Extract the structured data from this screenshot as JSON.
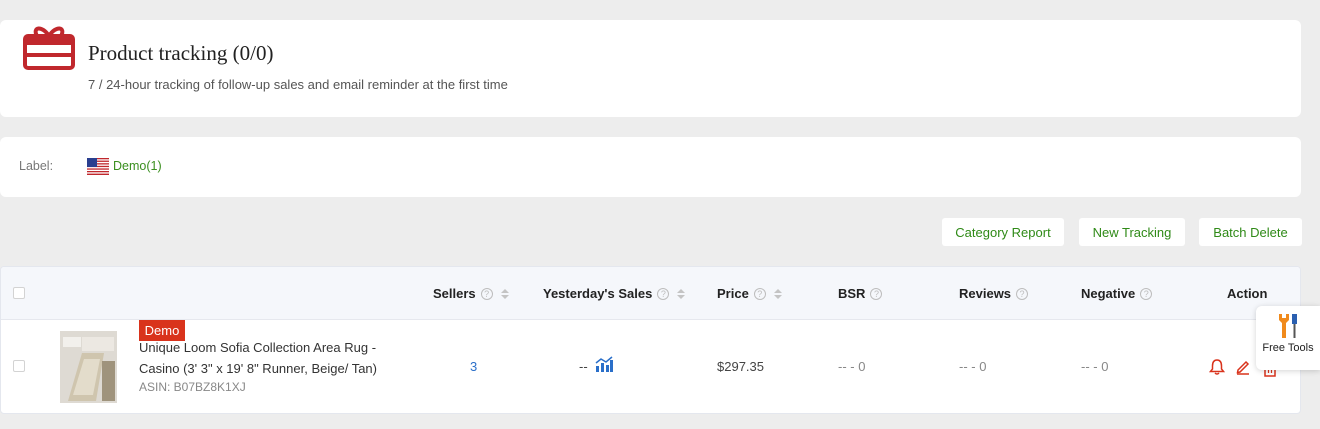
{
  "header": {
    "title": "Product tracking (0/0)",
    "subtitle": "7 / 24-hour tracking of follow-up sales and email reminder at the first time",
    "icon": "gift-box-icon"
  },
  "labels": {
    "title": "Label:",
    "items": [
      {
        "flag": "us-flag-icon",
        "text": "Demo(1)"
      }
    ]
  },
  "toolbar": {
    "category_report": "Category Report",
    "new_tracking": "New Tracking",
    "batch_delete": "Batch Delete"
  },
  "table": {
    "columns": {
      "sellers": "Sellers",
      "yesterday_sales": "Yesterday's Sales",
      "price": "Price",
      "bsr": "BSR",
      "reviews": "Reviews",
      "negative": "Negative",
      "action": "Action"
    },
    "help_glyph": "?",
    "rows": [
      {
        "badge": "Demo",
        "name": "Unique Loom Sofia Collection Area Rug - Casino (3' 3\" x 19' 8\" Runner, Beige/ Tan)",
        "asin": "ASIN: B07BZ8K1XJ",
        "sellers": "3",
        "yesterday_sales": "--",
        "price": "$297.35",
        "bsr": "-- - 0",
        "reviews": "-- - 0",
        "negative": "-- - 0"
      }
    ]
  },
  "free_tools": {
    "label": "Free Tools"
  },
  "colors": {
    "accent_green": "#2f8a17",
    "brand_red": "#c0282d",
    "badge_red": "#d9331c",
    "link_blue": "#2a6fc9"
  }
}
